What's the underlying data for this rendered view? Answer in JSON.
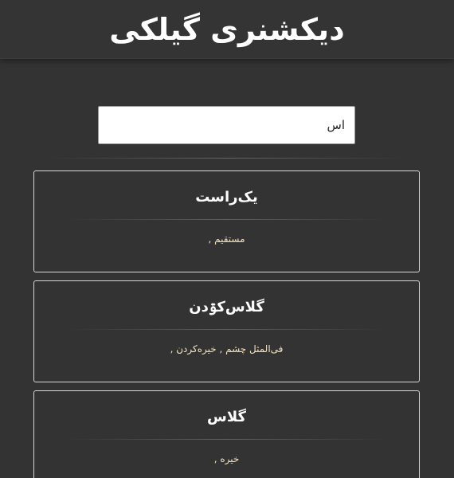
{
  "header": {
    "title": "دیکشنری گیلکی"
  },
  "search": {
    "value": "اس",
    "placeholder": ""
  },
  "results": [
    {
      "word": "یک‌راست",
      "meaning": "مستقیم ,"
    },
    {
      "word": "گلاس‌کۊدن",
      "meaning": "فی‌المثل چشم , خیره‌کردن ,"
    },
    {
      "word": "گلاس",
      "meaning": "خیره ,"
    }
  ],
  "colors": {
    "background": "#333333",
    "meaning_text": "#f3e2bf"
  }
}
